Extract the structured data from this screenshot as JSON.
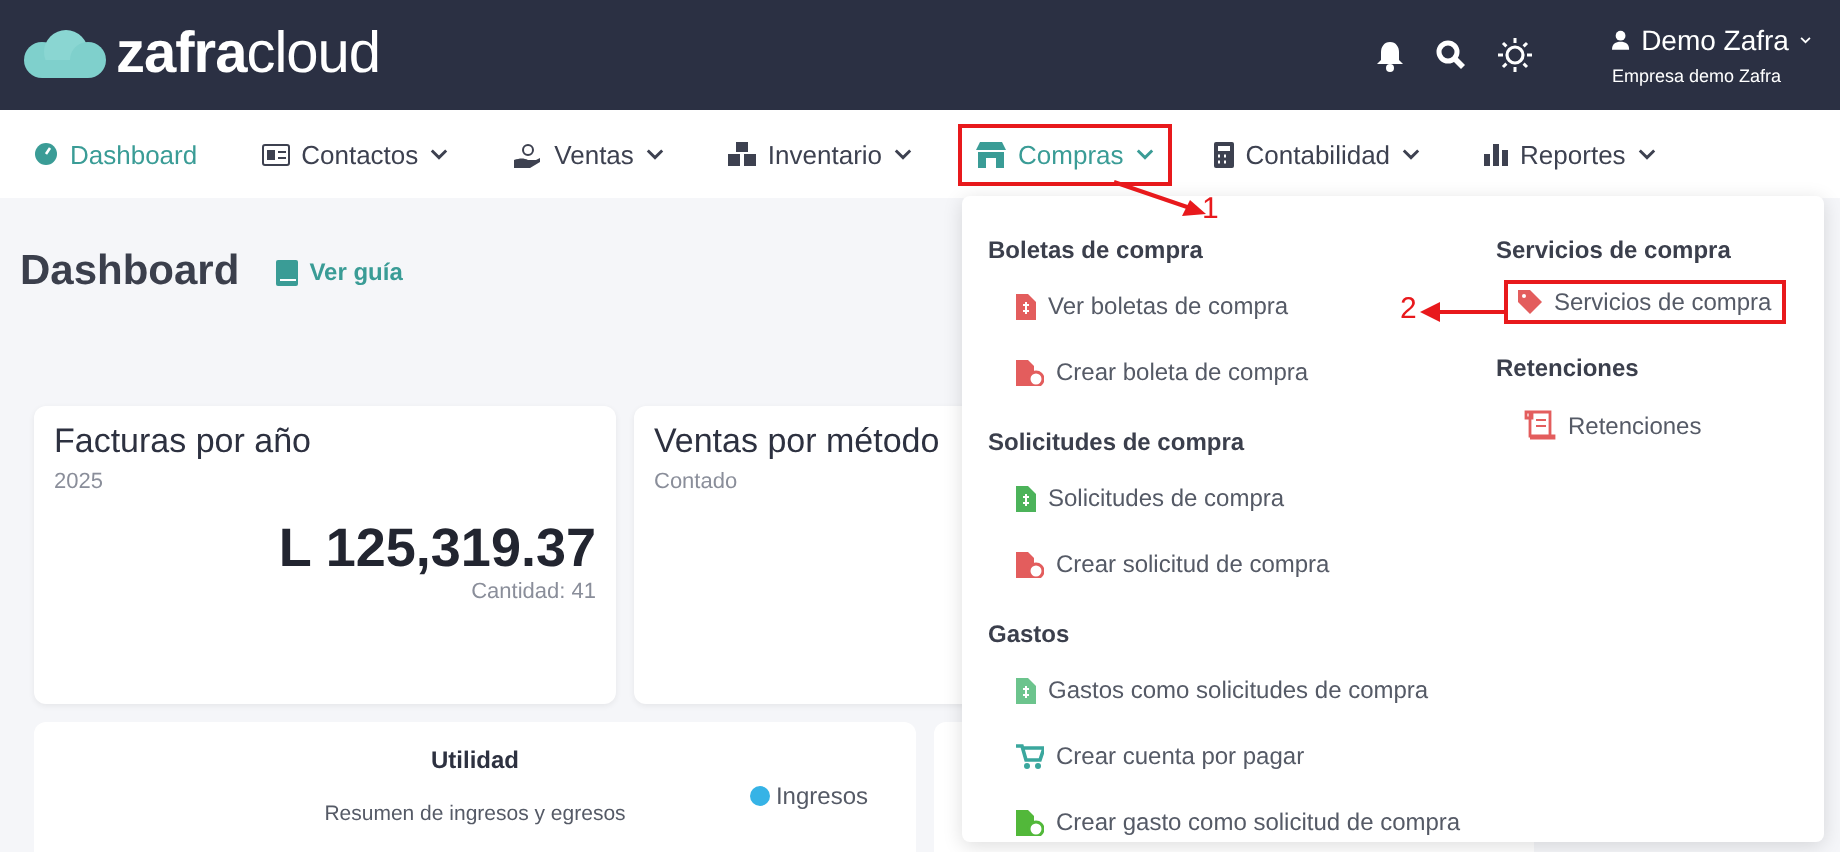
{
  "header": {
    "logo": {
      "bold": "zafra",
      "light": "cloud"
    },
    "user": {
      "name": "Demo Zafra",
      "company": "Empresa demo Zafra"
    }
  },
  "nav": [
    {
      "label": "Dashboard",
      "kind": "gauge",
      "selected": true,
      "dropdown": false,
      "annotated": false
    },
    {
      "label": "Contactos",
      "kind": "card",
      "selected": false,
      "dropdown": true,
      "annotated": false
    },
    {
      "label": "Ventas",
      "kind": "hand",
      "selected": false,
      "dropdown": true,
      "annotated": false
    },
    {
      "label": "Inventario",
      "kind": "boxes",
      "selected": false,
      "dropdown": true,
      "annotated": false
    },
    {
      "label": "Compras",
      "kind": "store",
      "selected": true,
      "dropdown": true,
      "annotated": true
    },
    {
      "label": "Contabilidad",
      "kind": "calc",
      "selected": false,
      "dropdown": true,
      "annotated": false
    },
    {
      "label": "Reportes",
      "kind": "chart",
      "selected": false,
      "dropdown": true,
      "annotated": false
    }
  ],
  "page": {
    "title": "Dashboard",
    "guide": "Ver guía"
  },
  "cards": [
    {
      "title": "Facturas por año",
      "subtitle": "2025",
      "amount": "L 125,319.37",
      "count": "Cantidad: 41"
    },
    {
      "title": "Ventas por método",
      "subtitle": "Contado"
    }
  ],
  "utility_card": {
    "title": "Utilidad",
    "subtitle": "Resumen de ingresos y egresos",
    "legend": [
      {
        "label": "Ingresos",
        "color": "#36b3e6"
      }
    ]
  },
  "menu": {
    "columns": [
      [
        {
          "title": "Boletas de compra",
          "items": [
            {
              "label": "Ver boletas de compra",
              "kind": "file",
              "color": "#e35d5d",
              "annotated": false
            },
            {
              "label": "Crear boleta de compra",
              "kind": "file-add",
              "color": "#e35d5d",
              "annotated": false
            }
          ]
        },
        {
          "title": "Solicitudes de compra",
          "items": [
            {
              "label": "Solicitudes de compra",
              "kind": "file",
              "color": "#4cb35a",
              "annotated": false
            },
            {
              "label": "Crear solicitud de compra",
              "kind": "file-add",
              "color": "#e35d5d",
              "annotated": false
            }
          ]
        },
        {
          "title": "Gastos",
          "items": [
            {
              "label": "Gastos como solicitudes de compra",
              "kind": "file",
              "color": "#6cc48d",
              "annotated": false
            },
            {
              "label": "Crear cuenta por pagar",
              "kind": "cart",
              "color": "#3aa79d",
              "annotated": false
            },
            {
              "label": "Crear gasto como solicitud de compra",
              "kind": "file-add",
              "color": "#52b83a",
              "annotated": false
            }
          ]
        }
      ],
      [
        {
          "title": "Servicios de compra",
          "items": [
            {
              "label": "Servicios de compra",
              "kind": "tag",
              "color": "#e35d5d",
              "annotated": true
            }
          ]
        },
        {
          "title": "Retenciones",
          "items": [
            {
              "label": "Retenciones",
              "kind": "scroll",
              "color": "#e35d5d",
              "annotated": false
            }
          ]
        }
      ]
    ]
  },
  "annotations": [
    {
      "label": "1"
    },
    {
      "label": "2"
    }
  ]
}
